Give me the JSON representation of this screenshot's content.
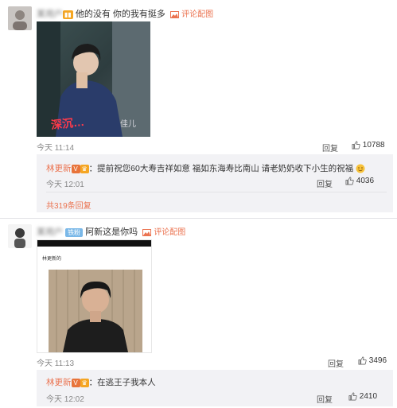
{
  "comment1": {
    "author": "某用户",
    "text": "他的没有 你的我有挺多",
    "pic_link": "评论配图",
    "overlay_caption": "深沉…",
    "overlay_tag": "佳儿",
    "time": "今天 11:14",
    "reply_label": "回复",
    "likes": "10788"
  },
  "reply1": {
    "author": "林更新",
    "text": "：提前祝您60大寿吉祥如意 福如东海寿比南山  请老奶奶收下小生的祝福",
    "time": "今天 12:01",
    "reply_label": "回复",
    "likes": "4036",
    "more_link": "共319条回复"
  },
  "comment2": {
    "author": "某用户",
    "fan_badge": "铁粉",
    "text": "阿新这是你吗",
    "pic_link": "评论配图",
    "photo_caption": "林更新的",
    "time": "今天 11:13",
    "reply_label": "回复",
    "likes": "3496"
  },
  "reply2": {
    "author": "林更新",
    "text": "：在逃王子我本人",
    "time": "今天 12:02",
    "reply_label": "回复",
    "likes": "2410"
  },
  "colors": {
    "accent": "#eb7350",
    "reply_bg": "#f2f2f5"
  }
}
